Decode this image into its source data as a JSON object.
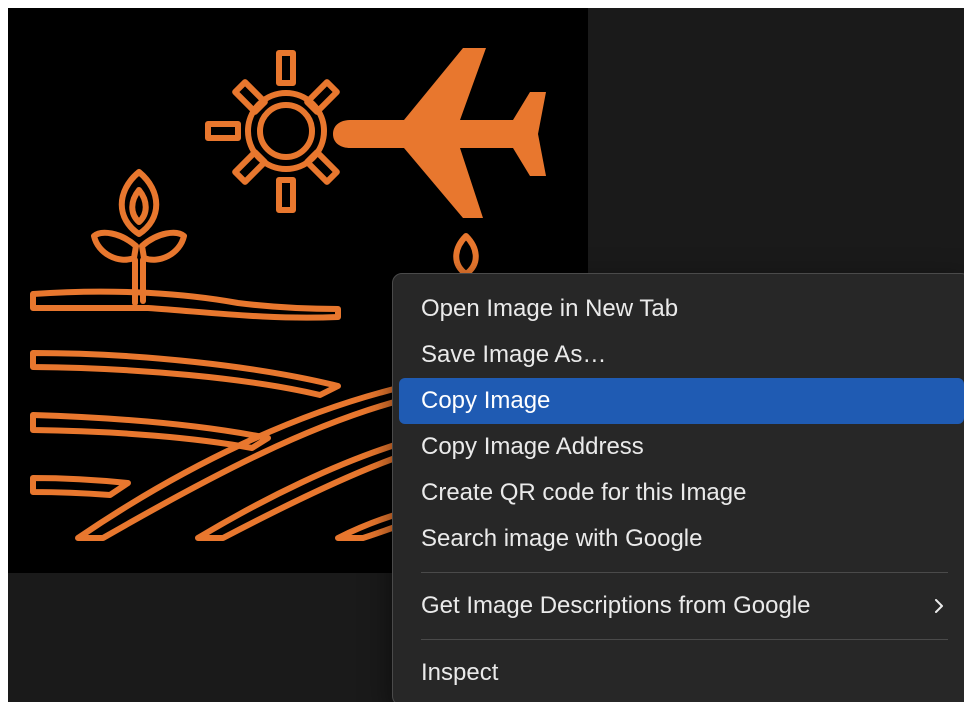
{
  "image": {
    "subject": "orange line-art icon: sun, airplane, plant sprouts and plowed field rows on black",
    "colors": {
      "stroke": "#e8772e",
      "background": "#000000"
    }
  },
  "context_menu": {
    "items": [
      {
        "label": "Open Image in New Tab"
      },
      {
        "label": "Save Image As…"
      },
      {
        "label": "Copy Image",
        "highlighted": true
      },
      {
        "label": "Copy Image Address"
      },
      {
        "label": "Create QR code for this Image"
      },
      {
        "label": "Search image with Google"
      },
      {
        "label": "Get Image Descriptions from Google",
        "has_submenu": true
      },
      {
        "label": "Inspect"
      }
    ],
    "highlight_color": "#1f5bb3",
    "submenu_icon": "chevron-right-icon"
  }
}
